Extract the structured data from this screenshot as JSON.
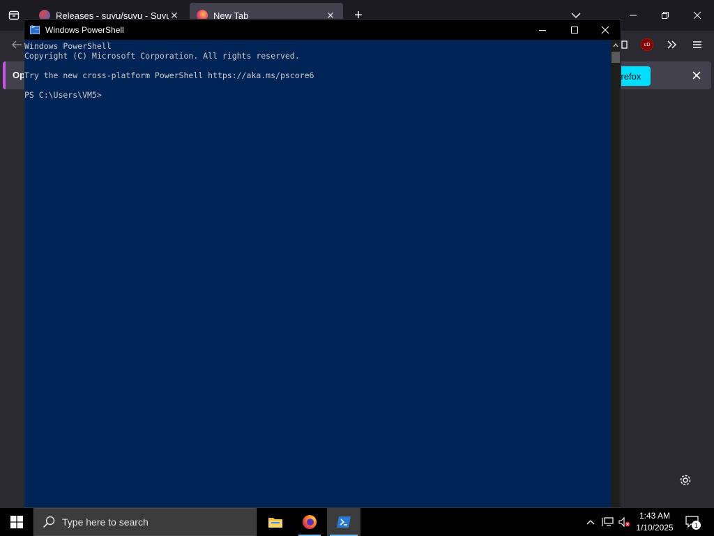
{
  "firefox": {
    "tabs": [
      {
        "label": "Releases - suyu/suyu - Suyu Git"
      },
      {
        "label": "New Tab"
      }
    ],
    "notice": {
      "left_text": "Op",
      "button_label": "Firefox"
    },
    "new_tab_symbol": "+",
    "close_symbol": "✕"
  },
  "powershell": {
    "title": "Windows PowerShell",
    "console_lines": [
      "Windows PowerShell",
      "Copyright (C) Microsoft Corporation. All rights reserved.",
      "",
      "Try the new cross-platform PowerShell https://aka.ms/pscore6",
      "",
      "PS C:\\Users\\VM5>"
    ]
  },
  "taskbar": {
    "search_placeholder": "Type here to search",
    "time": "1:43 AM",
    "date": "1/10/2025",
    "notification_count": "1"
  },
  "colors": {
    "powershell_bg": "#012456",
    "firefox_accent": "#00ddff",
    "taskbar_bg": "#000000"
  }
}
